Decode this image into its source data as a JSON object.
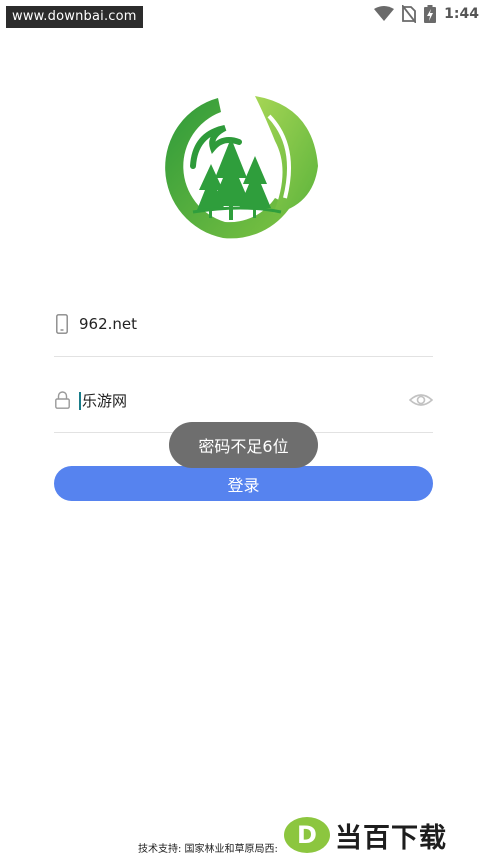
{
  "status_bar": {
    "watermark": "www.downbai.com",
    "time": "1:44"
  },
  "login": {
    "username_value": "962.net",
    "password_value": "乐游网",
    "toast": "密码不足6位",
    "login_label": "登录"
  },
  "footer": {
    "support_text": "技术支持: 国家林业和草原局西:",
    "watermark_logo": "当百下载"
  },
  "colors": {
    "button": "#5683ef",
    "logo_green": "#3aa83a",
    "logo_light_green": "#9bd04a",
    "toast_bg": "#6e6e6e"
  }
}
